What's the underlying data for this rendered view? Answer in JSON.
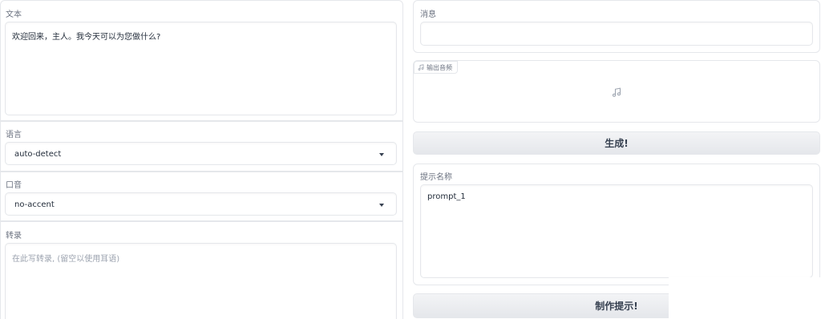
{
  "left": {
    "text_label": "文本",
    "text_value": "欢迎回来，主人。我今天可以为您做什么?",
    "language_label": "语言",
    "language_value": "auto-detect",
    "accent_label": "口音",
    "accent_value": "no-accent",
    "transcript_label": "转录",
    "transcript_placeholder": "在此写转录, (留空以使用耳语)"
  },
  "right": {
    "message_label": "消息",
    "message_value": "",
    "audio_label": "输出音频",
    "generate_button": "生成!",
    "prompt_name_label": "提示名称",
    "prompt_name_value": "prompt_1",
    "make_prompt_button": "制作提示!"
  }
}
